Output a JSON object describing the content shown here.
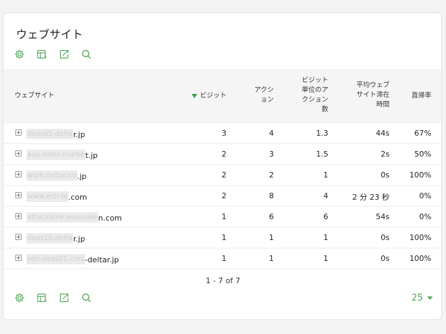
{
  "widget": {
    "title": "ウェブサイト",
    "toolbar_icons": [
      "settings-icon",
      "table-icon",
      "export-icon",
      "search-icon"
    ],
    "accent_color": "#5aa85f"
  },
  "table": {
    "columns": {
      "site": "ウェブサイト",
      "visits": "ビジット",
      "actions": "アクシ\nョン",
      "actions_per_visit": "ビジット\n単位のア\nクション\n数",
      "avg_time": "平均ウェブ\nサイト滞在\n時間",
      "bounce_rate": "直帰率"
    },
    "sort_column": "visits",
    "rows": [
      {
        "site_hidden": "daas05.delta",
        "site_visible": "r.jp",
        "visits": "3",
        "actions": "4",
        "apv": "1.3",
        "avg_time": "44s",
        "bounce": "67%"
      },
      {
        "site_hidden": "aop.sales-marke",
        "site_visible": "t.jp",
        "visits": "2",
        "actions": "3",
        "apv": "1.5",
        "avg_time": "2s",
        "bounce": "50%"
      },
      {
        "site_hidden": "work.deltar.co",
        "site_visible": ".jp",
        "visits": "2",
        "actions": "2",
        "apv": "1",
        "avg_time": "0s",
        "bounce": "100%"
      },
      {
        "site_hidden": "www.ecti-bl",
        "site_visible": ".com",
        "visits": "2",
        "actions": "8",
        "apv": "4",
        "avg_time": "2 分 23 秒",
        "bounce": "0%"
      },
      {
        "site_hidden": "attackable.masouke",
        "site_visible": "n.com",
        "visits": "1",
        "actions": "6",
        "apv": "6",
        "avg_time": "54s",
        "bounce": "0%"
      },
      {
        "site_hidden": "daas10.delta",
        "site_visible": "r.jp",
        "visits": "1",
        "actions": "1",
        "apv": "1",
        "avg_time": "0s",
        "bounce": "100%"
      },
      {
        "site_hidden": "sdn-daas01.cms",
        "site_visible": "-deltar.jp",
        "visits": "1",
        "actions": "1",
        "apv": "1",
        "avg_time": "0s",
        "bounce": "100%"
      }
    ]
  },
  "footer": {
    "pagination": "1 - 7 of 7",
    "per_page": "25"
  }
}
